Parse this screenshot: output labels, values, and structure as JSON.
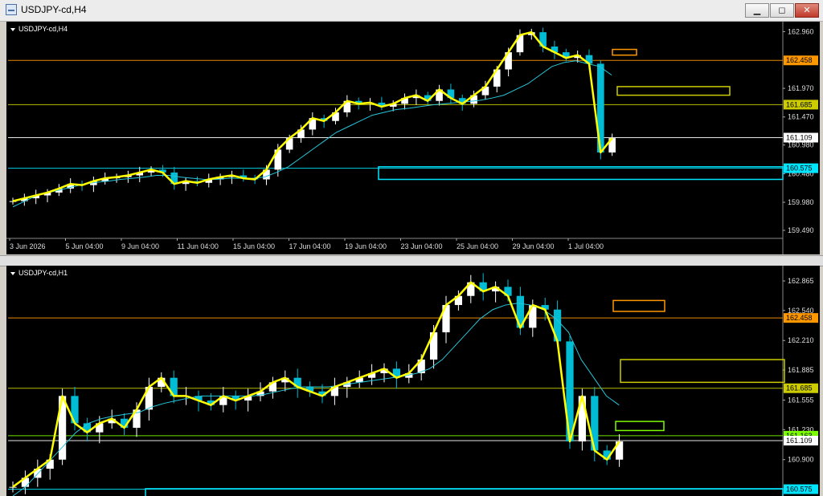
{
  "window": {
    "title": "USDJPY-cd,H4",
    "buttons": {
      "minimize": "▁",
      "maximize": "◻",
      "close": "✕"
    }
  },
  "colors": {
    "background": "#000000",
    "bull_candle": "#ffffff",
    "bear_candle": "#00bcd4",
    "moving_average": "#26c6da",
    "annotation_line": "#ffff00",
    "orange_level": "#ff9800",
    "yellow_level": "#cccc00",
    "green_level": "#7cfc00",
    "cyan_level": "#00e5ff"
  },
  "chart_data": [
    {
      "type": "candlestick",
      "symbol": "USDJPY-cd,H4",
      "y_ticks": [
        "162.960",
        "162.458",
        "161.970",
        "161.685",
        "161.470",
        "161.109",
        "160.980",
        "160.575",
        "160.480",
        "159.980",
        "159.490"
      ],
      "ylim": [
        159.35,
        163.05
      ],
      "x_ticks": [
        "3 Jun 2026",
        "5 Jun 04:00",
        "9 Jun 04:00",
        "11 Jun 04:00",
        "15 Jun 04:00",
        "17 Jun 04:00",
        "19 Jun 04:00",
        "23 Jun 04:00",
        "25 Jun 04:00",
        "29 Jun 04:00",
        "1 Jul 04:00"
      ],
      "levels": [
        {
          "label": "162.458",
          "value": 162.458,
          "color": "#ff9800"
        },
        {
          "label": "161.685",
          "value": 161.685,
          "color": "#cccc00"
        },
        {
          "label": "161.109",
          "value": 161.109,
          "color": "#ffffff"
        },
        {
          "label": "160.575",
          "value": 160.575,
          "color": "#00e5ff"
        }
      ],
      "close_path": [
        160.0,
        160.05,
        160.1,
        160.15,
        160.22,
        160.3,
        160.28,
        160.35,
        160.4,
        160.42,
        160.45,
        160.5,
        160.55,
        160.5,
        160.3,
        160.35,
        160.32,
        160.38,
        160.42,
        160.45,
        160.4,
        160.38,
        160.55,
        160.9,
        161.1,
        161.25,
        161.45,
        161.4,
        161.55,
        161.75,
        161.7,
        161.72,
        161.65,
        161.7,
        161.8,
        161.85,
        161.75,
        161.95,
        161.8,
        161.7,
        161.85,
        162.0,
        162.3,
        162.6,
        162.9,
        162.95,
        162.7,
        162.6,
        162.5,
        162.55,
        162.4,
        160.85,
        161.1
      ],
      "ma_path": [
        159.9,
        160.0,
        160.1,
        160.15,
        160.2,
        160.25,
        160.3,
        160.33,
        160.35,
        160.38,
        160.4,
        160.42,
        160.45,
        160.45,
        160.42,
        160.4,
        160.38,
        160.38,
        160.4,
        160.4,
        160.4,
        160.42,
        160.5,
        160.6,
        160.75,
        160.9,
        161.05,
        161.2,
        161.3,
        161.4,
        161.5,
        161.55,
        161.6,
        161.62,
        161.65,
        161.68,
        161.7,
        161.72,
        161.74,
        161.76,
        161.8,
        161.85,
        161.95,
        162.05,
        162.2,
        162.35,
        162.42,
        162.45,
        162.4,
        162.35,
        162.2
      ]
    },
    {
      "type": "candlestick",
      "symbol": "USDJPY-cd,H1",
      "y_ticks": [
        "162.865",
        "162.540",
        "162.458",
        "162.210",
        "161.885",
        "161.685",
        "161.555",
        "161.230",
        "161.163",
        "161.109",
        "160.900"
      ],
      "ylim": [
        160.5,
        162.98
      ],
      "x_ticks": [],
      "levels": [
        {
          "label": "162.458",
          "value": 162.458,
          "color": "#ff9800"
        },
        {
          "label": "161.685",
          "value": 161.685,
          "color": "#cccc00"
        },
        {
          "label": "161.163",
          "value": 161.163,
          "color": "#7cfc00"
        },
        {
          "label": "161.109",
          "value": 161.109,
          "color": "#ffffff"
        },
        {
          "label": "160.575",
          "value": 160.575,
          "color": "#00e5ff"
        }
      ],
      "close_path": [
        160.6,
        160.7,
        160.8,
        160.9,
        161.6,
        161.3,
        161.2,
        161.3,
        161.35,
        161.25,
        161.45,
        161.7,
        161.8,
        161.6,
        161.6,
        161.55,
        161.5,
        161.6,
        161.55,
        161.6,
        161.65,
        161.75,
        161.8,
        161.7,
        161.65,
        161.6,
        161.7,
        161.75,
        161.8,
        161.85,
        161.9,
        161.8,
        161.85,
        162.0,
        162.3,
        162.6,
        162.7,
        162.85,
        162.75,
        162.8,
        162.7,
        162.35,
        162.6,
        162.55,
        162.2,
        161.1,
        161.6,
        161.0,
        160.9,
        161.1
      ],
      "ma_path": [
        160.5,
        160.6,
        160.75,
        160.9,
        161.05,
        161.2,
        161.3,
        161.35,
        161.38,
        161.4,
        161.42,
        161.48,
        161.52,
        161.55,
        161.58,
        161.6,
        161.6,
        161.6,
        161.6,
        161.6,
        161.62,
        161.65,
        161.68,
        161.7,
        161.7,
        161.7,
        161.72,
        161.74,
        161.76,
        161.78,
        161.8,
        161.82,
        161.85,
        161.9,
        162.0,
        162.15,
        162.3,
        162.45,
        162.55,
        162.6,
        162.62,
        162.6,
        162.55,
        162.45,
        162.3,
        162.0,
        161.8,
        161.6,
        161.5
      ]
    }
  ]
}
